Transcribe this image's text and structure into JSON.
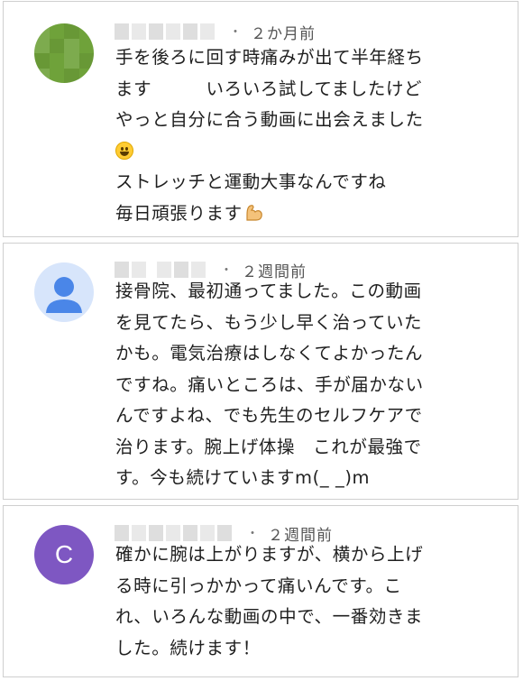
{
  "comments": [
    {
      "avatar": "blurred-mosaic-avatar",
      "timestamp": "２か月前",
      "lines": [
        "手を後ろに回す時痛みが出て半年経ち",
        "ます　　　いろいろ試してましたけど",
        "やっと自分に合う動画に出会えました"
      ],
      "lines_after_emoji": [
        "ストレッチと運動大事なんですね",
        "毎日頑張ります"
      ],
      "emojis": [
        "grinning-face-emoji",
        "flexed-biceps-emoji"
      ]
    },
    {
      "avatar": "default-person-avatar",
      "timestamp": "２週間前",
      "text": "接骨院、最初通ってました。この動画\nを見てたら、もう少し早く治っていた\nかも。電気治療はしなくてよかったん\nですね。痛いところは、手が届かない\nんですよね、でも先生のセルフケアで\n治ります。腕上げ体操　これが最強で\nす。今も続けていますm(_ _)m"
    },
    {
      "avatar_letter": "C",
      "timestamp": "２週間前",
      "text": "確かに腕は上がりますが、横から上げ\nる時に引っかかって痛いんです。こ\nれ、いろんな動画の中で、一番効きま\nした。続けます！"
    }
  ],
  "colors": {
    "avatar_green": "#6fa23a",
    "avatar_person_bg": "#d7e5fb",
    "avatar_person_fg": "#4a86e8",
    "avatar_letter_bg": "#7e57c2",
    "border": "#cfcfcf",
    "timestamp": "#555555"
  },
  "separator": "・"
}
